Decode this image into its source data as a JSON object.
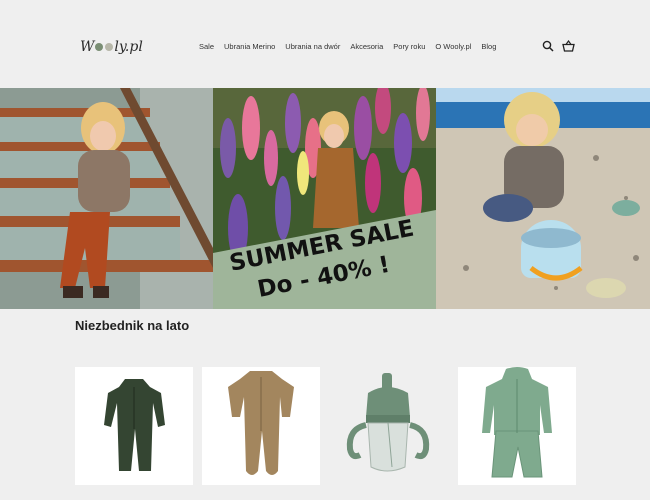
{
  "brand": {
    "logo_text_1": "W",
    "logo_text_2": "ly.pl",
    "dot_colors": [
      "#7a8e74",
      "#b7b7a9"
    ]
  },
  "nav": {
    "items": [
      "Sale",
      "Ubrania Merino",
      "Ubrania na dwór",
      "Akcesoria",
      "Pory roku",
      "O Wooly.pl",
      "Blog"
    ]
  },
  "icons": [
    "search-icon",
    "basket-icon"
  ],
  "banner": {
    "sale_line_1": "SUMMER SALE",
    "sale_line_2": "Do - 40% !"
  },
  "section": {
    "title": "Niezbednik na lato"
  },
  "products": [
    {
      "name": "green-overall",
      "color": "#344532"
    },
    {
      "name": "merino-romper",
      "color": "#a3865e"
    },
    {
      "name": "sippy-cup",
      "color": "#6e8f78"
    },
    {
      "name": "rain-set",
      "color": "#7faa8e"
    }
  ],
  "colors": {
    "background": "#efefef",
    "sale_banner_overlay": "#9fb59a"
  }
}
